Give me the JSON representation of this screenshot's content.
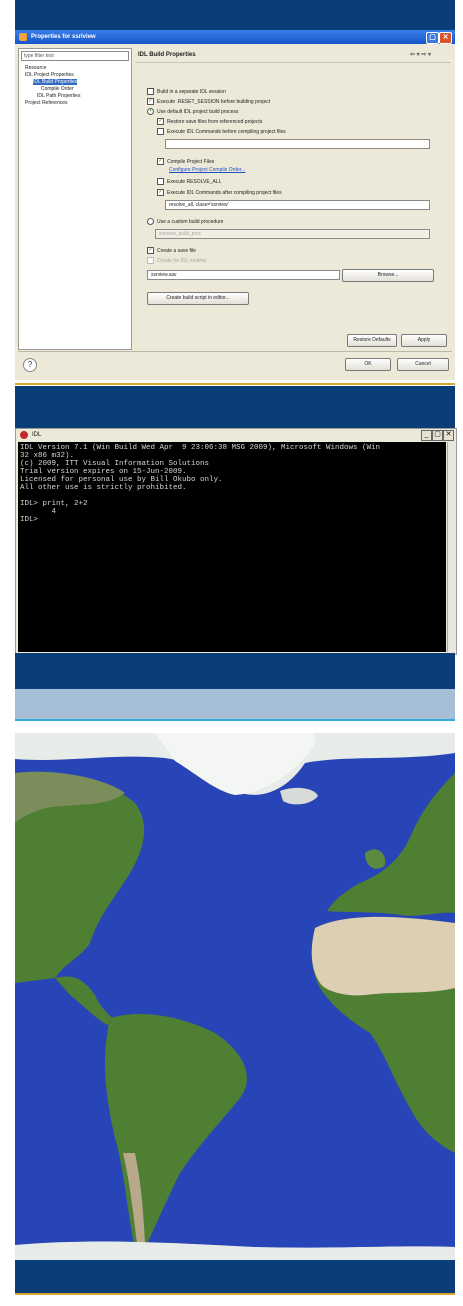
{
  "dialog": {
    "title": "Properties for ssriview",
    "filter_text": "type filter text",
    "tree": [
      "Resource",
      "IDL Project Properties",
      "IDL Build Properties",
      "Compile Order",
      "IDL Path Properties",
      "Project References"
    ],
    "page_title": "IDL Build Properties",
    "options": {
      "separate_session": "Build in a separate IDL session",
      "execute_before": "Execute .RESET_SESSION before building project",
      "use_default": "Use default IDL project build process",
      "restore_save": "Restore save files from referenced projects",
      "exec_cmds_before": "Execute IDL Commands before compiling project files",
      "compile_project": "Compile Project Files",
      "configure_order": "Configure Project Compile Order...",
      "resolve_all": "Execute RESOLVE_ALL",
      "exec_cmds_after": "Execute IDL Commands after compiling project files",
      "custom_build": "Use a custom build procedure",
      "create_save": "Create a save file",
      "create_runtime": "Create for IDL runtime"
    },
    "after_cmd_value": "resolve_all, class='ssrview'",
    "custom_proc_placeholder": "ssrview_build_proc",
    "save_file_value": "ssrview.sav",
    "browse_label": "Browse...",
    "wizard_label": "Create build script in editor...",
    "restore_defaults_label": "Restore Defaults",
    "apply_label": "Apply",
    "ok_label": "OK",
    "cancel_label": "Cancel",
    "help_glyph": "?"
  },
  "idl": {
    "title": "IDL",
    "lines": [
      "IDL Version 7.1 (Win32 x86 m32). (c) 2009, ITT Visual Information Solutions",
      "IDL Version 7.1 (Win Build Wed Apr  9 23:06:38 MSG 2009), Microsoft Windows (Win",
      "32 x86 m32).",
      "(c) 2009, ITT Visual Information Solutions",
      "Trial version expires on 15-Jun-2009.",
      "Licensed for personal use by Bill Okubo only.",
      "All other use is strictly prohibited.",
      "",
      "IDL> print, 2+2",
      "       4",
      "IDL>"
    ]
  },
  "colors": {
    "band": "#0b3d78",
    "gold": "#d8a732",
    "ocean": "#2845b8",
    "land": "#4f7f33"
  }
}
